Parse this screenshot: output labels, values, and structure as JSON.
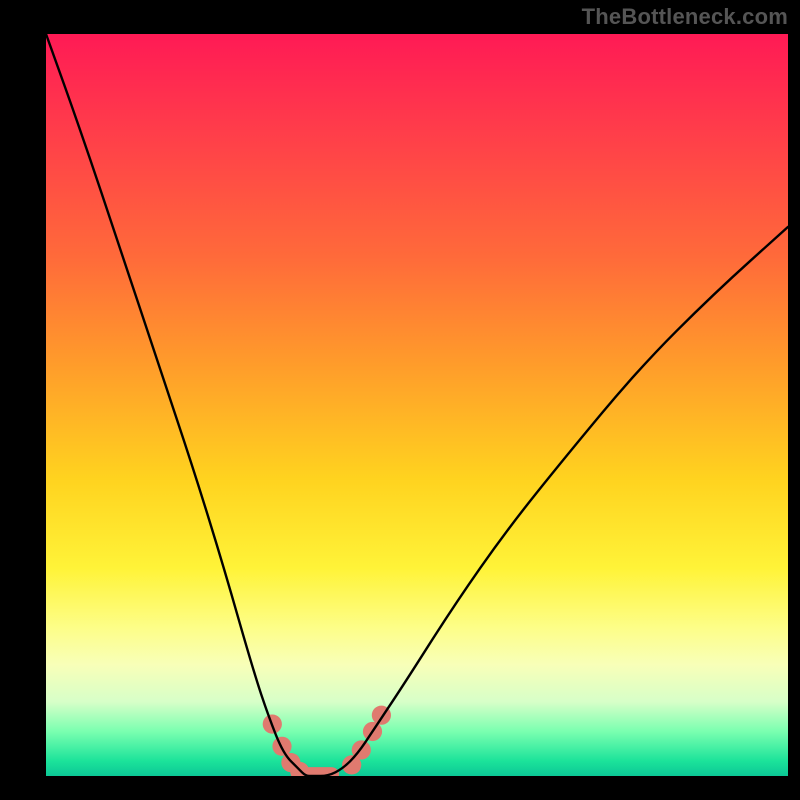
{
  "watermark": {
    "text": "TheBottleneck.com"
  },
  "chart_data": {
    "type": "line",
    "title": "",
    "xlabel": "",
    "ylabel": "",
    "xlim": [
      0,
      100
    ],
    "ylim": [
      0,
      100
    ],
    "grid": false,
    "legend": false,
    "series": [
      {
        "name": "curve",
        "color": "#000000",
        "x": [
          0,
          5,
          10,
          15,
          20,
          24,
          28,
          30,
          32,
          34,
          35,
          36,
          38,
          40,
          42,
          44,
          48,
          55,
          62,
          70,
          80,
          90,
          100
        ],
        "values": [
          100,
          86,
          71,
          56,
          41,
          28,
          14,
          8,
          3,
          1,
          0,
          0,
          0,
          1,
          3,
          6,
          12,
          23,
          33,
          43,
          55,
          65,
          74
        ]
      }
    ],
    "markers": [
      {
        "shape": "round-rect",
        "color": "#e07a6f",
        "x_range": [
          34.5,
          39.5
        ],
        "y_range": [
          0.0,
          1.2
        ]
      },
      {
        "shape": "dot",
        "color": "#e07a6f",
        "x": 30.5,
        "y": 7.0,
        "r": 1.3
      },
      {
        "shape": "dot",
        "color": "#e07a6f",
        "x": 31.8,
        "y": 4.0,
        "r": 1.3
      },
      {
        "shape": "dot",
        "color": "#e07a6f",
        "x": 33.0,
        "y": 1.8,
        "r": 1.3
      },
      {
        "shape": "dot",
        "color": "#e07a6f",
        "x": 34.2,
        "y": 0.6,
        "r": 1.3
      },
      {
        "shape": "dot",
        "color": "#e07a6f",
        "x": 41.2,
        "y": 1.5,
        "r": 1.3
      },
      {
        "shape": "dot",
        "color": "#e07a6f",
        "x": 42.5,
        "y": 3.5,
        "r": 1.3
      },
      {
        "shape": "dot",
        "color": "#e07a6f",
        "x": 44.0,
        "y": 6.0,
        "r": 1.3
      },
      {
        "shape": "dot",
        "color": "#e07a6f",
        "x": 45.2,
        "y": 8.2,
        "r": 1.3
      }
    ]
  }
}
